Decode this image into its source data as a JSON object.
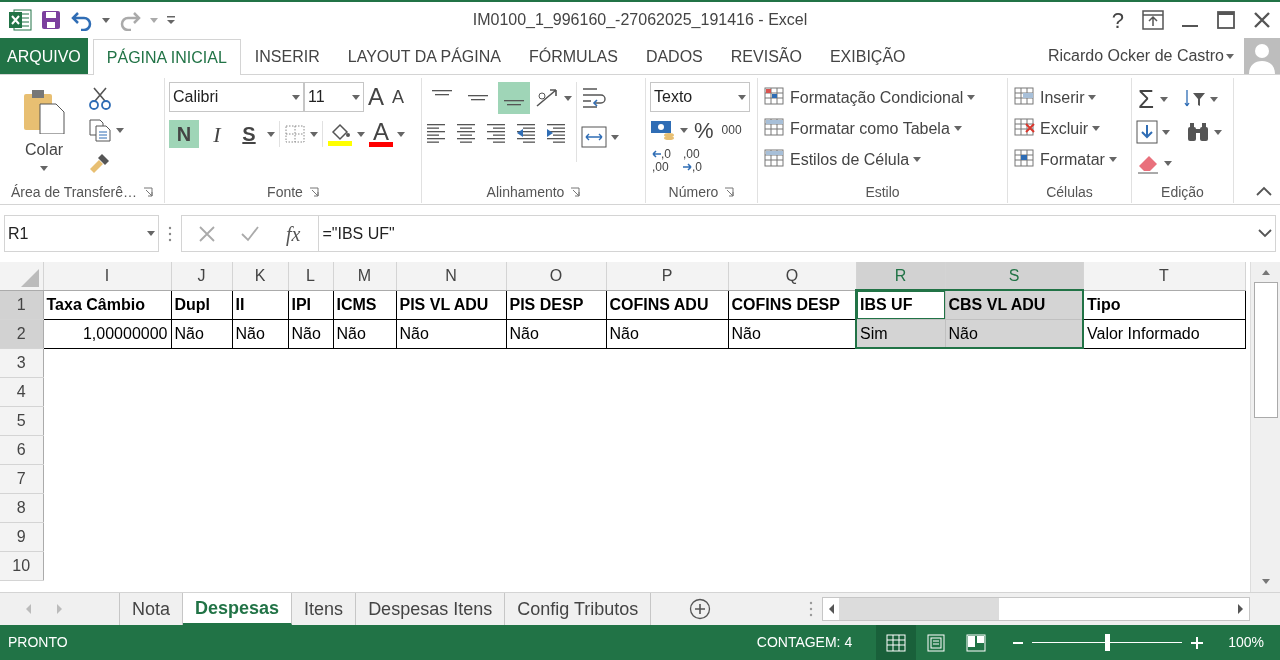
{
  "window": {
    "title": "IM0100_1_996160_-27062025_191416 - Excel",
    "help": "?"
  },
  "ribbon_tabs": [
    {
      "label": "ARQUIVO",
      "kind": "file",
      "selected": false
    },
    {
      "label": "PÁGINA INICIAL",
      "kind": "tab",
      "selected": true
    },
    {
      "label": "INSERIR",
      "kind": "tab",
      "selected": false
    },
    {
      "label": "LAYOUT DA PÁGINA",
      "kind": "tab",
      "selected": false
    },
    {
      "label": "FÓRMULAS",
      "kind": "tab",
      "selected": false
    },
    {
      "label": "DADOS",
      "kind": "tab",
      "selected": false
    },
    {
      "label": "REVISÃO",
      "kind": "tab",
      "selected": false
    },
    {
      "label": "EXIBIÇÃO",
      "kind": "tab",
      "selected": false
    }
  ],
  "user": {
    "name": "Ricardo Ocker de Castro"
  },
  "clipboard": {
    "paste": "Colar",
    "group_label": "Área de Transferê…"
  },
  "font": {
    "name": "Calibri",
    "size": "11",
    "grow": "A",
    "shrink": "A",
    "bold": {
      "label": "N",
      "on": true
    },
    "italic": {
      "label": "I",
      "on": false
    },
    "underline": {
      "label": "S",
      "on": false
    },
    "font_color": "A",
    "group_label": "Fonte"
  },
  "alignment": {
    "vertical": [
      {
        "kind": "top",
        "selected": false
      },
      {
        "kind": "middle",
        "selected": false
      },
      {
        "kind": "bottom",
        "selected": true
      }
    ],
    "group_label": "Alinhamento"
  },
  "number": {
    "format": "Texto",
    "percent": "%",
    "thousands": "000",
    "decimal_increase": {
      "top": ",0",
      "bottom": ",00"
    },
    "decimal_decrease": {
      "top": ",00",
      "bottom": ",0"
    },
    "group_label": "Número"
  },
  "styles": {
    "items": [
      "Formatação Condicional",
      "Formatar como Tabela",
      "Estilos de Célula"
    ],
    "group_label": "Estilo"
  },
  "cells_group": {
    "items": [
      "Inserir",
      "Excluir",
      "Formatar"
    ],
    "group_label": "Células"
  },
  "editing": {
    "sum": "Σ",
    "group_label": "Edição"
  },
  "formula_bar": {
    "name_box": "R1",
    "fx": "fx",
    "formula": "=\"IBS UF\""
  },
  "sheet": {
    "columns": [
      {
        "letter": "I",
        "selected": false
      },
      {
        "letter": "J",
        "selected": false
      },
      {
        "letter": "K",
        "selected": false
      },
      {
        "letter": "L",
        "selected": false
      },
      {
        "letter": "M",
        "selected": false
      },
      {
        "letter": "N",
        "selected": false
      },
      {
        "letter": "O",
        "selected": false
      },
      {
        "letter": "P",
        "selected": false
      },
      {
        "letter": "Q",
        "selected": false
      },
      {
        "letter": "R",
        "selected": true
      },
      {
        "letter": "S",
        "selected": true
      },
      {
        "letter": "T",
        "selected": false
      }
    ],
    "rows": [
      {
        "number": "1",
        "selected": true,
        "cells": [
          {
            "text": "Taxa Câmbio",
            "kind": "header",
            "selected": false,
            "active": false
          },
          {
            "text": "Dupl",
            "kind": "header",
            "selected": false,
            "active": false
          },
          {
            "text": "II",
            "kind": "header",
            "selected": false,
            "active": false
          },
          {
            "text": "IPI",
            "kind": "header",
            "selected": false,
            "active": false
          },
          {
            "text": "ICMS",
            "kind": "header",
            "selected": false,
            "active": false
          },
          {
            "text": "PIS VL ADU",
            "kind": "header",
            "selected": false,
            "active": false
          },
          {
            "text": "PIS DESP",
            "kind": "header",
            "selected": false,
            "active": false
          },
          {
            "text": "COFINS ADU",
            "kind": "header",
            "selected": false,
            "active": false
          },
          {
            "text": "COFINS DESP",
            "kind": "header",
            "selected": false,
            "active": false
          },
          {
            "text": "IBS UF",
            "kind": "header",
            "selected": true,
            "active": true
          },
          {
            "text": "CBS VL ADU",
            "kind": "header",
            "selected": true,
            "active": false
          },
          {
            "text": "Tipo",
            "kind": "header",
            "selected": false,
            "active": false
          }
        ]
      },
      {
        "number": "2",
        "selected": true,
        "cells": [
          {
            "text": "1,00000000",
            "kind": "number",
            "selected": false,
            "active": false
          },
          {
            "text": "Não",
            "kind": "text",
            "selected": false,
            "active": false
          },
          {
            "text": "Não",
            "kind": "text",
            "selected": false,
            "active": false
          },
          {
            "text": "Não",
            "kind": "text",
            "selected": false,
            "active": false
          },
          {
            "text": "Não",
            "kind": "text",
            "selected": false,
            "active": false
          },
          {
            "text": "Não",
            "kind": "text",
            "selected": false,
            "active": false
          },
          {
            "text": "Não",
            "kind": "text",
            "selected": false,
            "active": false
          },
          {
            "text": "Não",
            "kind": "text",
            "selected": false,
            "active": false
          },
          {
            "text": "Não",
            "kind": "text",
            "selected": false,
            "active": false
          },
          {
            "text": "Sim",
            "kind": "text",
            "selected": true,
            "active": false
          },
          {
            "text": "Não",
            "kind": "text",
            "selected": true,
            "active": false
          },
          {
            "text": "Valor Informado",
            "kind": "text",
            "selected": false,
            "active": false
          }
        ]
      },
      {
        "number": "3",
        "selected": false,
        "cells": []
      },
      {
        "number": "4",
        "selected": false,
        "cells": []
      },
      {
        "number": "5",
        "selected": false,
        "cells": []
      },
      {
        "number": "6",
        "selected": false,
        "cells": []
      },
      {
        "number": "7",
        "selected": false,
        "cells": []
      },
      {
        "number": "8",
        "selected": false,
        "cells": []
      },
      {
        "number": "9",
        "selected": false,
        "cells": []
      },
      {
        "number": "10",
        "selected": false,
        "cells": []
      }
    ]
  },
  "sheet_tabs": [
    {
      "label": "Nota",
      "selected": false
    },
    {
      "label": "Despesas",
      "selected": true
    },
    {
      "label": "Itens",
      "selected": false
    },
    {
      "label": "Despesas Itens",
      "selected": false
    },
    {
      "label": "Config Tributos",
      "selected": false
    }
  ],
  "status_bar": {
    "mode": "PRONTO",
    "count": "CONTAGEM: 4",
    "views": [
      {
        "kind": "normal",
        "selected": true
      },
      {
        "kind": "page_layout",
        "selected": false
      },
      {
        "kind": "page_break",
        "selected": false
      }
    ],
    "zoom_slider": {
      "level": 0.5
    },
    "zoom": "100%"
  }
}
